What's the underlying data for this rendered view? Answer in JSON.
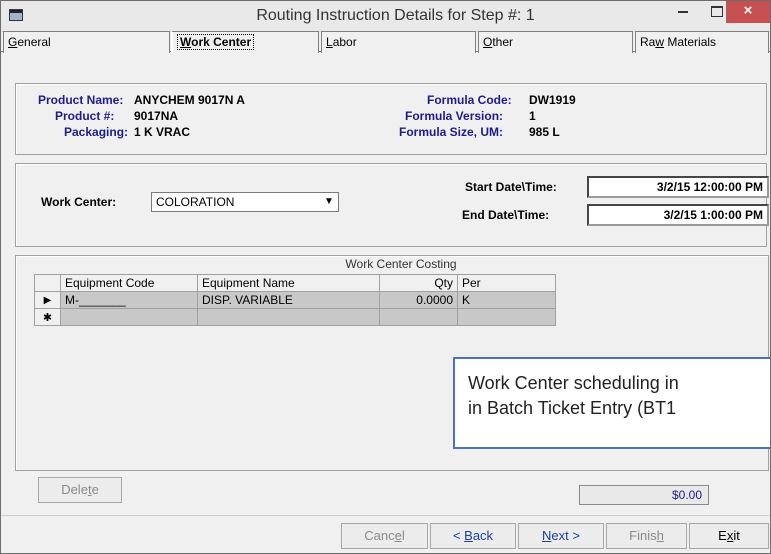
{
  "window": {
    "title": "Routing Instruction Details for Step #: 1",
    "close_glyph": "×"
  },
  "tabs": [
    {
      "label_u": "G",
      "label_rest": "eneral"
    },
    {
      "label_u": "W",
      "label_rest": "ork Center"
    },
    {
      "label_u": "L",
      "label_rest": "abor"
    },
    {
      "label_u": "O",
      "label_rest": "ther"
    },
    {
      "label_pre": "Ra",
      "label_u": "w",
      "label_rest": " Materials"
    }
  ],
  "info": {
    "product_name_label": "Product Name:",
    "product_name": "ANYCHEM 9017N A",
    "product_num_label": "Product #:",
    "product_num": "9017NA",
    "packaging_label": "Packaging:",
    "packaging": "1 K VRAC",
    "formula_code_label": "Formula Code:",
    "formula_code": "DW1919",
    "formula_version_label": "Formula Version:",
    "formula_version": "1",
    "formula_size_label": "Formula Size, UM:",
    "formula_size": "985 L"
  },
  "work_center": {
    "label": "Work Center:",
    "value": "COLORATION",
    "start_label": "Start Date\\Time:",
    "start_value": "3/2/15 12:00:00 PM",
    "end_label": "End Date\\Time:",
    "end_value": "3/2/15 1:00:00 PM"
  },
  "grid": {
    "title": "Work Center Costing",
    "headers": [
      "Equipment Code",
      "Equipment Name",
      "Qty",
      "Per"
    ],
    "rows": [
      [
        "M-_______",
        "DISP. VARIABLE",
        "0.0000",
        "K"
      ]
    ],
    "current_row_glyph": "▶",
    "new_row_glyph": "✱"
  },
  "callout": {
    "line1": "Work Center scheduling in",
    "line2": "in Batch Ticket Entry (BT1"
  },
  "footer": {
    "delete_pre": "Dele",
    "delete_u": "t",
    "delete_rest": "e",
    "total": "$0.00",
    "cancel_pre": "Canc",
    "cancel_u": "e",
    "cancel_rest": "l",
    "back_arrow": "< ",
    "back_u": "B",
    "back_rest": "ack",
    "next_u": "N",
    "next_rest": "ext",
    "next_arrow": " >",
    "finish_pre": "Finis",
    "finish_u": "h",
    "exit_pre": "E",
    "exit_u": "x",
    "exit_rest": "it"
  }
}
